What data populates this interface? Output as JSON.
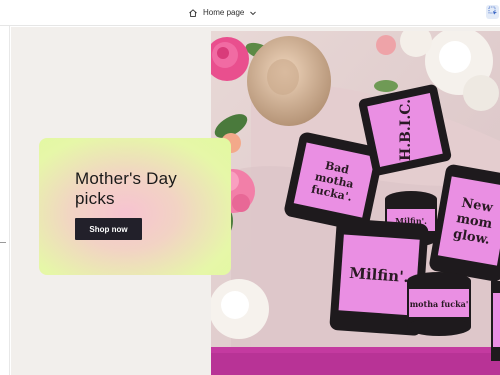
{
  "toolbar": {
    "page_selector_label": "Home page",
    "home_icon": "home-icon",
    "chevron_icon": "chevron-down-icon",
    "select_tool_icon": "select-tool-icon"
  },
  "promo": {
    "title": "Mother's Day picks",
    "button_label": "Shop now"
  },
  "hero_image": {
    "candles": [
      {
        "label": "Bad motha fucka'."
      },
      {
        "label": "H.B.I.C."
      },
      {
        "label": "Milfin'."
      },
      {
        "label": "New mom glow."
      },
      {
        "label": "Milfin'."
      },
      {
        "label": "motha fucka'"
      }
    ]
  },
  "colors": {
    "button_bg": "#22202a",
    "card_green": "#e2f8a0",
    "card_pink": "#f7c3d1",
    "label_pink": "#ea8fe3",
    "canvas_bg": "#f2efec"
  }
}
